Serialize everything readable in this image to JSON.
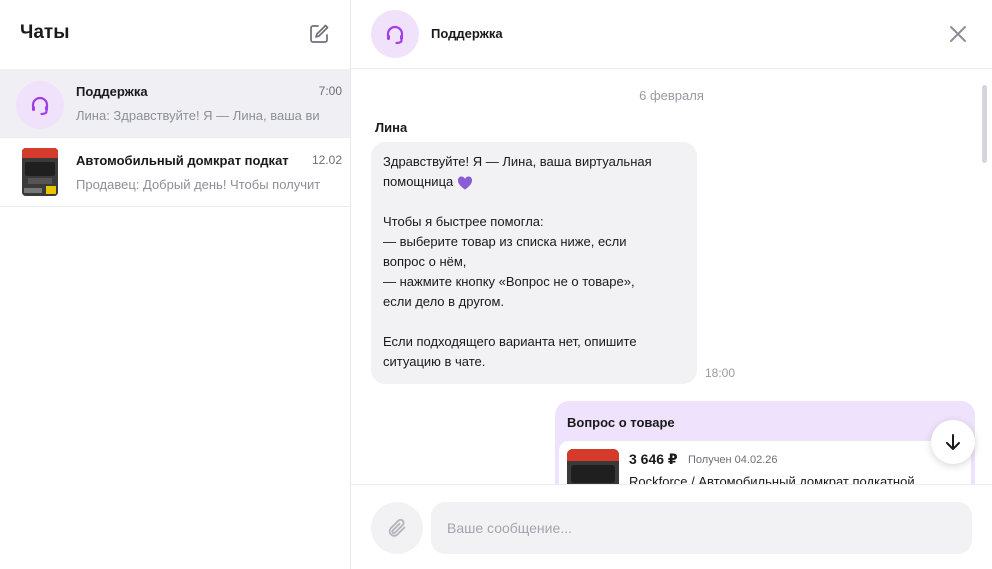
{
  "sidebar": {
    "title": "Чаты",
    "compose_icon": "compose-icon",
    "chats": [
      {
        "name": "Поддержка",
        "time": "7:00",
        "preview": "Лина: Здравствуйте! Я — Лина, ваша ви",
        "icon": "headset-icon",
        "active": true
      },
      {
        "name": "Автомобильный домкрат подкат",
        "time": "12.02",
        "preview": "Продавец: Добрый день! Чтобы получит",
        "icon": "product-thumbnail",
        "active": false
      }
    ]
  },
  "chat": {
    "title": "Поддержка",
    "icon": "headset-icon",
    "close_icon": "close-icon",
    "date": "6 февраля",
    "sender": "Лина",
    "incoming": {
      "lines": [
        "Здравствуйте! Я — Лина, ваша виртуальная",
        "помощница",
        "",
        "Чтобы я быстрее помогла:",
        "— выберите товар из списка ниже, если",
        "вопрос о нём,",
        "— нажмите кнопку «Вопрос не о товаре»,",
        "если дело в другом.",
        "",
        "Если подходящего варианта нет, опишите",
        "ситуацию в чате."
      ],
      "time": "18:00"
    },
    "outgoing": {
      "title": "Вопрос о товаре",
      "product": {
        "price": "3 646 ₽",
        "status": "Получен 04.02.26",
        "name": "Rockforce / Автомобильный домкрат подкатной"
      }
    }
  },
  "composer": {
    "placeholder": "Ваше сообщение...",
    "attach_icon": "paperclip-icon"
  },
  "colors": {
    "accent": "#a13ee8",
    "avatar_bg": "#f1e2fb",
    "outgoing_bubble": "#efe2fc",
    "incoming_bubble": "#f2f2f5",
    "active_row": "#f0f0f4"
  }
}
